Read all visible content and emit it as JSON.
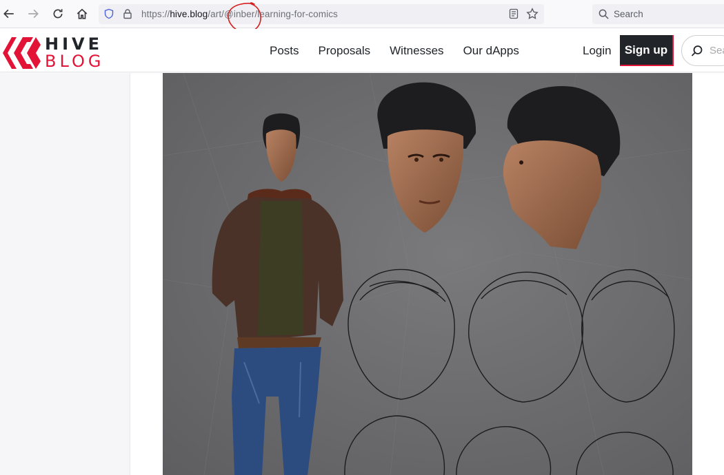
{
  "browser": {
    "url_prefix": "https://",
    "url_host": "hive.blog",
    "url_path": "/art/@inber/learning-for-comics",
    "search_placeholder": "Search",
    "annotation_color": "#d42020"
  },
  "site": {
    "logo_top": "HIVE",
    "logo_bottom": "BLOG",
    "brand_color": "#e31337",
    "nav": [
      {
        "label": "Posts"
      },
      {
        "label": "Proposals"
      },
      {
        "label": "Witnesses"
      },
      {
        "label": "Our dApps"
      }
    ],
    "login_label": "Login",
    "signup_label": "Sign up",
    "search_placeholder": "Sea"
  },
  "icons": [
    "back-arrow-icon",
    "forward-arrow-icon",
    "reload-icon",
    "home-icon",
    "shield-icon",
    "lock-icon",
    "reader-view-icon",
    "bookmark-star-icon",
    "search-icon",
    "hive-logo-icon"
  ]
}
